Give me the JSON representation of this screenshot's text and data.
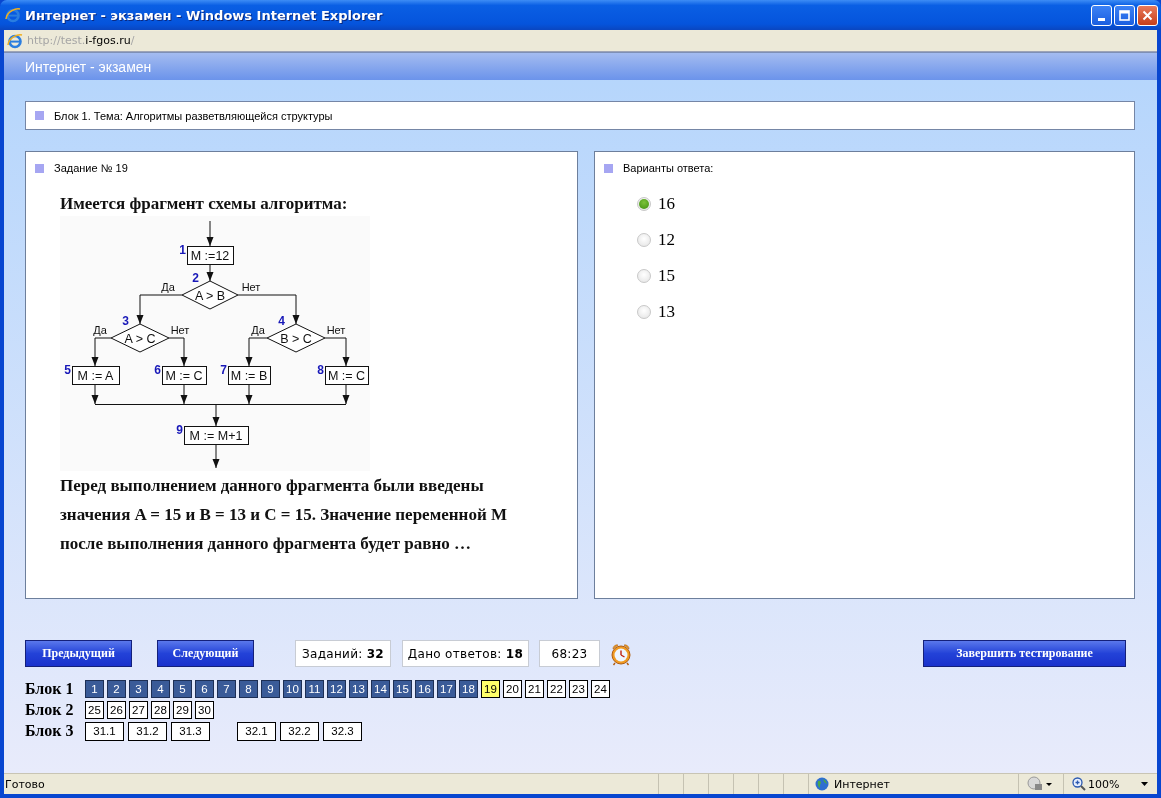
{
  "window": {
    "title": "Интернет - экзамен - Windows Internet Explorer",
    "address_prefix": "http://test.",
    "address_domain": "i-fgos.ru",
    "address_suffix": "/"
  },
  "page_header": "Интернет - экзамен",
  "topic": "Блок 1. Тема: Алгоритмы разветвляющейся структуры",
  "task": {
    "title": "Задание № 19",
    "intro": "Имеется фрагмент схемы алгоритма:",
    "flowchart": {
      "nodes": [
        {
          "number": "1",
          "text": "M :=12",
          "kind": "process"
        },
        {
          "number": "2",
          "text": "A > B",
          "kind": "decision",
          "yes_label": "Да",
          "no_label": "Нет"
        },
        {
          "number": "3",
          "text": "A > C",
          "kind": "decision",
          "yes_label": "Да",
          "no_label": "Нет"
        },
        {
          "number": "4",
          "text": "B > C",
          "kind": "decision",
          "yes_label": "Да",
          "no_label": "Нет"
        },
        {
          "number": "5",
          "text": "M := A",
          "kind": "process"
        },
        {
          "number": "6",
          "text": "M := C",
          "kind": "process"
        },
        {
          "number": "7",
          "text": "M := B",
          "kind": "process"
        },
        {
          "number": "8",
          "text": "M := C",
          "kind": "process"
        },
        {
          "number": "9",
          "text": "M := M+1",
          "kind": "process"
        }
      ]
    },
    "question": "Перед выполнением данного фрагмента были введены значения A = 15 и B = 13 и C = 15. Значение переменной M после выполнения данного фрагмента будет равно …"
  },
  "answers": {
    "title": "Варианты ответа:",
    "options": [
      {
        "label": "16",
        "selected": true
      },
      {
        "label": "12",
        "selected": false
      },
      {
        "label": "15",
        "selected": false
      },
      {
        "label": "13",
        "selected": false
      }
    ]
  },
  "controls": {
    "prev": "Предыдущий",
    "next": "Следующий",
    "tasks": "Заданий: **32**",
    "answered": "Дано ответов: **18**",
    "timer": "68:23",
    "finish": "Завершить тестирование"
  },
  "blocks": [
    {
      "label": "Блок 1",
      "groups": [
        {
          "items": [
            {
              "label": "1",
              "answered": true,
              "selected": false
            },
            {
              "label": "2",
              "answered": true,
              "selected": false
            },
            {
              "label": "3",
              "answered": true,
              "selected": false
            },
            {
              "label": "4",
              "answered": true,
              "selected": false
            },
            {
              "label": "5",
              "answered": true,
              "selected": false
            },
            {
              "label": "6",
              "answered": true,
              "selected": false
            },
            {
              "label": "7",
              "answered": true,
              "selected": false
            },
            {
              "label": "8",
              "answered": true,
              "selected": false
            },
            {
              "label": "9",
              "answered": true,
              "selected": false
            },
            {
              "label": "10",
              "answered": true,
              "selected": false
            },
            {
              "label": "11",
              "answered": true,
              "selected": false
            },
            {
              "label": "12",
              "answered": true,
              "selected": false
            },
            {
              "label": "13",
              "answered": true,
              "selected": false
            },
            {
              "label": "14",
              "answered": true,
              "selected": false
            },
            {
              "label": "15",
              "answered": true,
              "selected": false
            },
            {
              "label": "16",
              "answered": true,
              "selected": false
            },
            {
              "label": "17",
              "answered": true,
              "selected": false
            },
            {
              "label": "18",
              "answered": true,
              "selected": false
            },
            {
              "label": "19",
              "answered": false,
              "selected": true
            },
            {
              "label": "20",
              "answered": false,
              "selected": false
            },
            {
              "label": "21",
              "answered": false,
              "selected": false
            },
            {
              "label": "22",
              "answered": false,
              "selected": false
            },
            {
              "label": "23",
              "answered": false,
              "selected": false
            },
            {
              "label": "24",
              "answered": false,
              "selected": false
            }
          ]
        }
      ]
    },
    {
      "label": "Блок 2",
      "groups": [
        {
          "items": [
            {
              "label": "25",
              "answered": false,
              "selected": false
            },
            {
              "label": "26",
              "answered": false,
              "selected": false
            },
            {
              "label": "27",
              "answered": false,
              "selected": false
            },
            {
              "label": "28",
              "answered": false,
              "selected": false
            },
            {
              "label": "29",
              "answered": false,
              "selected": false
            },
            {
              "label": "30",
              "answered": false,
              "selected": false
            }
          ]
        }
      ]
    },
    {
      "label": "Блок 3",
      "groups": [
        {
          "items": [
            {
              "label": "31.1",
              "answered": false,
              "selected": false
            },
            {
              "label": "31.2",
              "answered": false,
              "selected": false
            },
            {
              "label": "31.3",
              "answered": false,
              "selected": false
            }
          ]
        },
        {
          "items": [
            {
              "label": "32.1",
              "answered": false,
              "selected": false
            },
            {
              "label": "32.2",
              "answered": false,
              "selected": false
            },
            {
              "label": "32.3",
              "answered": false,
              "selected": false
            }
          ]
        }
      ]
    }
  ],
  "status_bar": {
    "text": "Готово",
    "zone": "Интернет",
    "zoom": "100%"
  }
}
